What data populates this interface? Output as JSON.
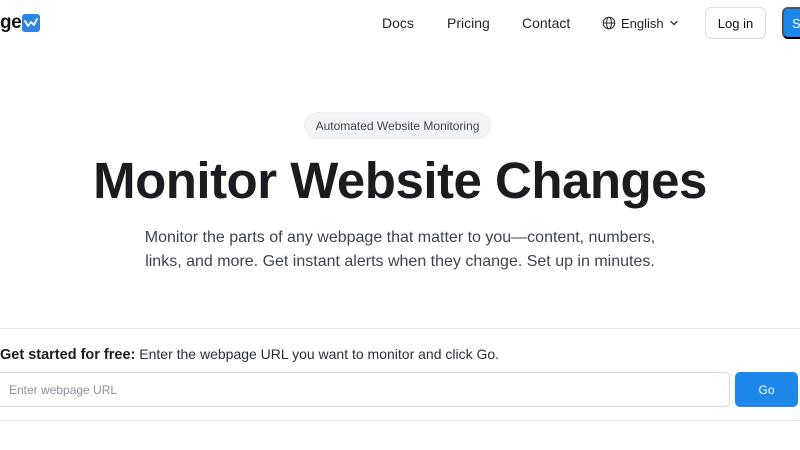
{
  "header": {
    "logo_text": "ge",
    "logo_icon": "chart-line-icon",
    "nav": {
      "docs": "Docs",
      "pricing": "Pricing",
      "contact": "Contact"
    },
    "language": {
      "icon": "globe-icon",
      "selected": "English",
      "chevron": "chevron-down-icon"
    },
    "login_label": "Log in",
    "cta_label": "S"
  },
  "hero": {
    "badge": "Automated Website Monitoring",
    "title": "Monitor Website Changes",
    "subtitle_line1": "Monitor the parts of any webpage that matter to you—content, numbers,",
    "subtitle_line2": "links, and more. Get instant alerts when they change. Set up in minutes."
  },
  "get_started": {
    "lead": "Get started for free:",
    "instruction": "Enter the webpage URL you want to monitor and click Go.",
    "input_placeholder": "Enter webpage URL",
    "go_label": "Go"
  },
  "colors": {
    "accent": "#1e88ea",
    "text": "#1f2328"
  }
}
